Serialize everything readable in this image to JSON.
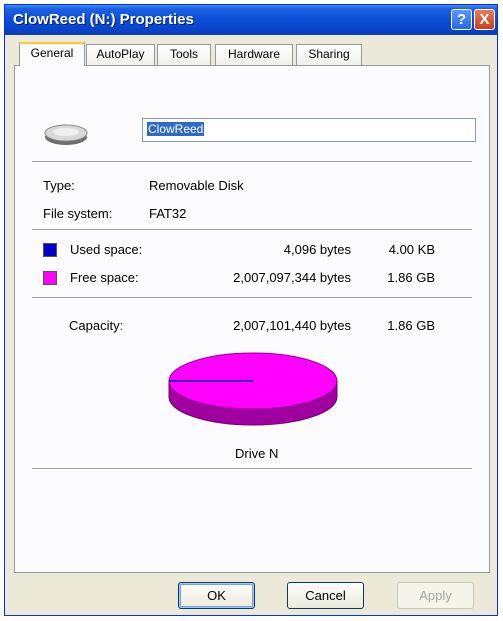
{
  "window": {
    "title": "ClowReed (N:) Properties",
    "help_glyph": "?",
    "close_glyph": "X"
  },
  "tabs": [
    {
      "label": "General",
      "active": true
    },
    {
      "label": "AutoPlay"
    },
    {
      "label": "Tools"
    },
    {
      "label": "Hardware"
    },
    {
      "label": "Sharing"
    }
  ],
  "general": {
    "drive_icon": "removable-disk-icon",
    "name_value": "ClowReed",
    "type_label": "Type:",
    "type_value": "Removable Disk",
    "fs_label": "File system:",
    "fs_value": "FAT32",
    "used": {
      "label": "Used space:",
      "bytes": "4,096 bytes",
      "size": "4.00 KB",
      "color": "#0000c8"
    },
    "free": {
      "label": "Free space:",
      "bytes": "2,007,097,344 bytes",
      "size": "1.86 GB",
      "color": "#ff00ff"
    },
    "capacity": {
      "label": "Capacity:",
      "bytes": "2,007,101,440 bytes",
      "size": "1.86 GB"
    },
    "drive_caption": "Drive N"
  },
  "buttons": {
    "ok": "OK",
    "cancel": "Cancel",
    "apply": "Apply"
  }
}
